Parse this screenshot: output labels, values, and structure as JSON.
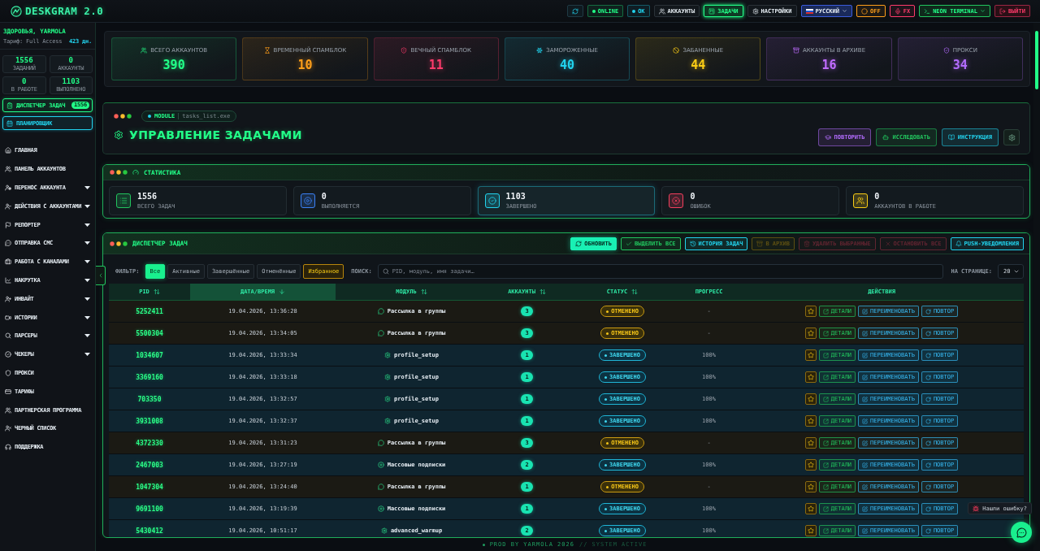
{
  "topbar": {
    "logo": "DESKGRAM 2.0",
    "indicators": [
      {
        "label": "ONLINE",
        "color": "#22ff88"
      },
      {
        "label": "OK",
        "color": "#22d3ee"
      }
    ],
    "nav": [
      {
        "label": "АККАУНТЫ",
        "selected": false
      },
      {
        "label": "ЗАДАЧИ",
        "selected": true
      },
      {
        "label": "НАСТРОЙКИ",
        "selected": false
      }
    ],
    "language": "РУССКИЙ",
    "toggles": [
      {
        "label": "OFF",
        "color": "#ff9f1a"
      },
      {
        "label": "FX",
        "color": "#ff3b6b"
      }
    ],
    "theme": "NEON TERMINAL",
    "logout": "ВЫЙТИ"
  },
  "sidebar": {
    "greeting": "ЗДОРОВЬЯ, YARMOLA",
    "plan": "Тариф: Full Access",
    "days_left": "423 дн.",
    "stats": [
      {
        "value": "1556",
        "label": "ЗАДАНИЙ"
      },
      {
        "value": "0",
        "label": "АККАУНТЫ"
      },
      {
        "value": "0",
        "label": "В РАБОТЕ"
      },
      {
        "value": "1103",
        "label": "ВЫПОЛНЕНО"
      }
    ],
    "shortcuts": [
      {
        "label": "ДИСПЕТЧЕР ЗАДАЧ",
        "badge": "1556",
        "color": "#22ff88"
      },
      {
        "label": "ПЛАНИРОВЩИК",
        "color": "#22d3ee"
      }
    ],
    "items": [
      {
        "label": "ГЛАВНАЯ",
        "submenu": false
      },
      {
        "label": "ПАНЕЛЬ АККАУНТОВ",
        "submenu": false
      },
      {
        "label": "ПЕРЕНОС АККАУНТА",
        "submenu": true
      },
      {
        "label": "ДЕЙСТВИЯ С АККАУНТАМИ",
        "submenu": true
      },
      {
        "label": "РЕПОРТЕР",
        "submenu": true
      },
      {
        "label": "ОТПРАВКА СМС",
        "submenu": true
      },
      {
        "label": "РАБОТА С КАНАЛАМИ",
        "submenu": true
      },
      {
        "label": "НАКРУТКА",
        "submenu": true
      },
      {
        "label": "ИНВАЙТ",
        "submenu": true
      },
      {
        "label": "ИСТОРИИ",
        "submenu": true
      },
      {
        "label": "ПАРСЕРЫ",
        "submenu": true
      },
      {
        "label": "ЧЕКЕРЫ",
        "submenu": true
      },
      {
        "label": "ПРОКСИ",
        "submenu": false
      },
      {
        "label": "ТАРИФЫ",
        "submenu": false
      },
      {
        "label": "ПАРТНЕРСКАЯ ПРОГРАММА",
        "submenu": false
      },
      {
        "label": "ЧЕРНЫЙ СПИСОК",
        "submenu": false
      },
      {
        "label": "ПОДДЕРЖКА",
        "submenu": false
      }
    ]
  },
  "account_summary": [
    {
      "label": "ВСЕГО АККАУНТОВ",
      "value": "390",
      "color": "#22ff88"
    },
    {
      "label": "ВРЕМЕННЫЙ СПАМБЛОК",
      "value": "10",
      "color": "#ff9f1a"
    },
    {
      "label": "ВЕЧНЫЙ СПАМБЛОК",
      "value": "11",
      "color": "#ff3b6b"
    },
    {
      "label": "ЗАМОРОЖЕННЫЕ",
      "value": "40",
      "color": "#22d3ee"
    },
    {
      "label": "ЗАБАНЕННЫЕ",
      "value": "44",
      "color": "#facc15"
    },
    {
      "label": "АККАУНТЫ В АРХИВЕ",
      "value": "16",
      "color": "#c06cff"
    },
    {
      "label": "ПРОКСИ",
      "value": "34",
      "color": "#b36cff"
    }
  ],
  "module": {
    "tag": "MODULE",
    "file": "tasks_list.exe",
    "title": "УПРАВЛЕНИЕ ЗАДАЧАМИ",
    "buttons": [
      {
        "label": "ПОВТОРИТЬ",
        "color": "#b36cff"
      },
      {
        "label": "ИССЛЕДОВАТЬ",
        "color": "#22c55e"
      },
      {
        "label": "ИНСТРУКЦИЯ",
        "color": "#22d3ee"
      }
    ]
  },
  "statistics": {
    "title": "СТАТИСТИКА",
    "cards": [
      {
        "value": "1556",
        "label": "ВСЕГО ЗАДАЧ",
        "color": "#22c55e",
        "highlighted": false
      },
      {
        "value": "0",
        "label": "ВЫПОЛНЯЕТСЯ",
        "color": "#3b82f6",
        "highlighted": false
      },
      {
        "value": "1103",
        "label": "ЗАВЕРШЕНО",
        "color": "#22d3ee",
        "highlighted": true
      },
      {
        "value": "0",
        "label": "ОШИБОК",
        "color": "#f43f5e",
        "highlighted": false
      },
      {
        "value": "0",
        "label": "АККАУНТОВ В РАБОТЕ",
        "color": "#facc15",
        "highlighted": false
      }
    ]
  },
  "dispatcher": {
    "title": "ДИСПЕТЧЕР ЗАДАЧ",
    "buttons": [
      {
        "label": "ОБНОВИТЬ",
        "kind": "primary",
        "disabled": false
      },
      {
        "label": "ВЫДЕЛИТЬ ВСЕ",
        "kind": "success",
        "disabled": false
      },
      {
        "label": "ИСТОРИЯ ЗАДАЧ",
        "kind": "info",
        "disabled": false
      },
      {
        "label": "В АРХИВ",
        "kind": "warning",
        "disabled": true
      },
      {
        "label": "УДАЛИТЬ ВЫБРАННЫЕ",
        "kind": "danger",
        "disabled": true
      },
      {
        "label": "ОСТАНОВИТЬ ВСЕ",
        "kind": "danger",
        "disabled": true
      },
      {
        "label": "PUSH-УВЕДОМЛЕНИЯ",
        "kind": "info",
        "disabled": false
      }
    ],
    "filter": {
      "label": "ФИЛЬТР:",
      "options": [
        {
          "label": "Все",
          "kind": "status",
          "selected": true
        },
        {
          "label": "Активные",
          "kind": "status",
          "selected": false
        },
        {
          "label": "Завершённые",
          "kind": "status",
          "selected": false
        },
        {
          "label": "Отменённые",
          "kind": "status",
          "selected": false
        },
        {
          "label": "Избранное",
          "kind": "favorite",
          "selected": false
        }
      ]
    },
    "search": {
      "label": "ПОИСК:",
      "placeholder": "PID, модуль, имя задачи…"
    },
    "page_size": {
      "label": "НА СТРАНИЦЕ:",
      "value": "20"
    },
    "table": {
      "columns": [
        {
          "label": "PID",
          "sortable": true,
          "sorted": false
        },
        {
          "label": "ДАТА/ВРЕМЯ",
          "sortable": true,
          "sorted": true
        },
        {
          "label": "МОДУЛЬ",
          "sortable": true,
          "sorted": false
        },
        {
          "label": "АККАУНТЫ",
          "sortable": true,
          "sorted": false
        },
        {
          "label": "СТАТУС",
          "sortable": true,
          "sorted": false
        },
        {
          "label": "ПРОГРЕСС",
          "sortable": false,
          "sorted": false
        },
        {
          "label": "ДЕЙСТВИЯ",
          "sortable": false,
          "sorted": false
        }
      ],
      "rows": [
        {
          "pid": "5252411",
          "datetime": "19.04.2026, 13:36:28",
          "module": {
            "name": "Рассылка в группы",
            "kind": "chat"
          },
          "accounts": "3",
          "status": {
            "label": "ОТМЕНЕНО",
            "kind": "cancelled"
          },
          "progress": "-",
          "favorite": false,
          "actions": [
            "ДЕТАЛИ",
            "ПЕРЕИМЕНОВАТЬ",
            "ПОВТОР"
          ]
        },
        {
          "pid": "5500304",
          "datetime": "19.04.2026, 13:34:05",
          "module": {
            "name": "Рассылка в группы",
            "kind": "chat"
          },
          "accounts": "3",
          "status": {
            "label": "ОТМЕНЕНО",
            "kind": "cancelled"
          },
          "progress": "-",
          "favorite": false,
          "actions": [
            "ДЕТАЛИ",
            "ПЕРЕИМЕНОВАТЬ",
            "ПОВТОР"
          ]
        },
        {
          "pid": "1034607",
          "datetime": "19.04.2026, 13:33:34",
          "module": {
            "name": "profile_setup",
            "kind": "gear"
          },
          "accounts": "1",
          "status": {
            "label": "ЗАВЕРШЕНО",
            "kind": "completed"
          },
          "progress": "100%",
          "favorite": false,
          "actions": [
            "ДЕТАЛИ",
            "ПЕРЕИМЕНОВАТЬ",
            "ПОВТОР"
          ]
        },
        {
          "pid": "3369160",
          "datetime": "19.04.2026, 13:33:18",
          "module": {
            "name": "profile_setup",
            "kind": "gear"
          },
          "accounts": "1",
          "status": {
            "label": "ЗАВЕРШЕНО",
            "kind": "completed"
          },
          "progress": "100%",
          "favorite": false,
          "actions": [
            "ДЕТАЛИ",
            "ПЕРЕИМЕНОВАТЬ",
            "ПОВТОР"
          ]
        },
        {
          "pid": "703350",
          "datetime": "19.04.2026, 13:32:57",
          "module": {
            "name": "profile_setup",
            "kind": "gear"
          },
          "accounts": "1",
          "status": {
            "label": "ЗАВЕРШЕНО",
            "kind": "completed"
          },
          "progress": "100%",
          "favorite": false,
          "actions": [
            "ДЕТАЛИ",
            "ПЕРЕИМЕНОВАТЬ",
            "ПОВТОР"
          ]
        },
        {
          "pid": "3931008",
          "datetime": "19.04.2026, 13:32:37",
          "module": {
            "name": "profile_setup",
            "kind": "gear"
          },
          "accounts": "1",
          "status": {
            "label": "ЗАВЕРШЕНО",
            "kind": "completed"
          },
          "progress": "100%",
          "favorite": false,
          "actions": [
            "ДЕТАЛИ",
            "ПЕРЕИМЕНОВАТЬ",
            "ПОВТОР"
          ]
        },
        {
          "pid": "4372330",
          "datetime": "19.04.2026, 13:31:23",
          "module": {
            "name": "Рассылка в группы",
            "kind": "chat"
          },
          "accounts": "3",
          "status": {
            "label": "ОТМЕНЕНО",
            "kind": "cancelled"
          },
          "progress": "-",
          "favorite": false,
          "actions": [
            "ДЕТАЛИ",
            "ПЕРЕИМЕНОВАТЬ",
            "ПОВТОР"
          ]
        },
        {
          "pid": "2467003",
          "datetime": "19.04.2026, 13:27:19",
          "module": {
            "name": "Массовые подписки",
            "kind": "plus"
          },
          "accounts": "2",
          "status": {
            "label": "ЗАВЕРШЕНО",
            "kind": "completed"
          },
          "progress": "100%",
          "favorite": false,
          "actions": [
            "ДЕТАЛИ",
            "ПЕРЕИМЕНОВАТЬ",
            "ПОВТОР"
          ]
        },
        {
          "pid": "1047304",
          "datetime": "19.04.2026, 13:24:40",
          "module": {
            "name": "Рассылка в группы",
            "kind": "chat"
          },
          "accounts": "1",
          "status": {
            "label": "ОТМЕНЕНО",
            "kind": "cancelled"
          },
          "progress": "-",
          "favorite": false,
          "actions": [
            "ДЕТАЛИ",
            "ПЕРЕИМЕНОВАТЬ",
            "ПОВТОР"
          ]
        },
        {
          "pid": "9691100",
          "datetime": "19.04.2026, 13:19:39",
          "module": {
            "name": "Массовые подписки",
            "kind": "plus"
          },
          "accounts": "1",
          "status": {
            "label": "ЗАВЕРШЕНО",
            "kind": "completed"
          },
          "progress": "100%",
          "favorite": false,
          "actions": [
            "ДЕТАЛИ",
            "ПЕРЕИМЕНОВАТЬ",
            "ПОВТОР"
          ]
        },
        {
          "pid": "5430412",
          "datetime": "19.04.2026, 10:51:17",
          "module": {
            "name": "advanced_warmup",
            "kind": "gear"
          },
          "accounts": "2",
          "status": {
            "label": "ЗАВЕРШЕНО",
            "kind": "completed"
          },
          "progress": "100%",
          "favorite": false,
          "actions": [
            "ДЕТАЛИ",
            "ПЕРЕИМЕНОВАТЬ",
            "ПОВТОР"
          ]
        }
      ]
    }
  },
  "footer": {
    "credit": "PROD BY YARMOLA 2026",
    "status": "// SYSTEM ACTIVE"
  },
  "feedback": {
    "label": "Нашли ошибку?"
  }
}
